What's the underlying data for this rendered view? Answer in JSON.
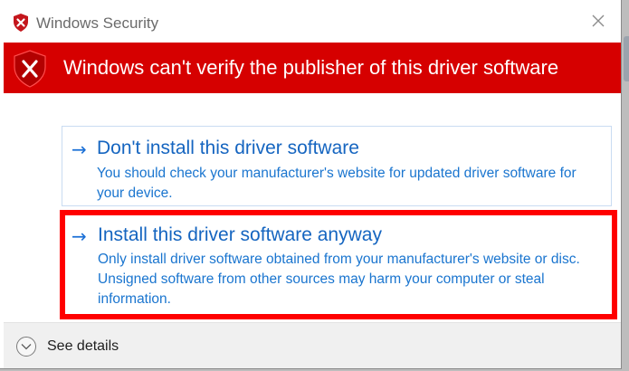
{
  "window": {
    "title": "Windows Security"
  },
  "header": {
    "message": "Windows can't verify the publisher of this driver software",
    "color": "#d60000"
  },
  "options": [
    {
      "title": "Don't install this driver software",
      "description": "You should check your manufacturer's website for updated driver software for your device.",
      "icon": "arrow-right-icon"
    },
    {
      "title": "Install this driver software anyway",
      "description": "Only install driver software obtained from your manufacturer's website or disc. Unsigned software from other sources may harm your computer or steal information.",
      "icon": "arrow-right-icon",
      "highlight_color": "#ff0000"
    }
  ],
  "footer": {
    "details_label": "See details",
    "icon": "chevron-down-icon"
  },
  "colors": {
    "link": "#1565c0",
    "link_desc": "#1a75cf",
    "footer_bg": "#f0f0f0"
  }
}
